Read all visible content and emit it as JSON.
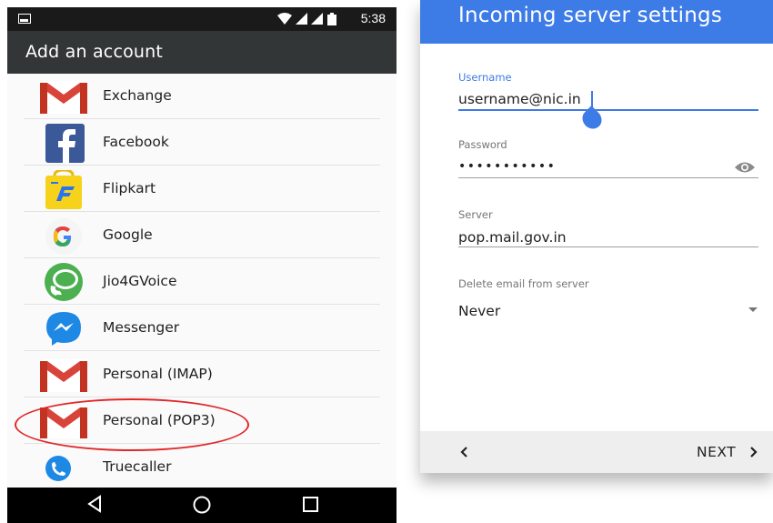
{
  "status_bar": {
    "time": "5:38"
  },
  "add_account": {
    "title": "Add an account",
    "accounts": [
      {
        "label": "Exchange",
        "icon": "gmail-icon"
      },
      {
        "label": "Facebook",
        "icon": "facebook-icon"
      },
      {
        "label": "Flipkart",
        "icon": "flipkart-icon"
      },
      {
        "label": "Google",
        "icon": "google-icon"
      },
      {
        "label": "Jio4GVoice",
        "icon": "jio4gvoice-icon"
      },
      {
        "label": "Messenger",
        "icon": "messenger-icon"
      },
      {
        "label": "Personal (IMAP)",
        "icon": "gmail-icon"
      },
      {
        "label": "Personal (POP3)",
        "icon": "gmail-icon"
      },
      {
        "label": "Truecaller",
        "icon": "truecaller-icon"
      }
    ],
    "highlighted": "Personal (POP3)",
    "highlight_color": "#e0282a"
  },
  "incoming_settings": {
    "title": "Incoming server settings",
    "username": {
      "label": "Username",
      "value": "username@nic.in"
    },
    "password": {
      "label": "Password",
      "value": "•••••••••••"
    },
    "server": {
      "label": "Server",
      "value": "pop.mail.gov.in"
    },
    "delete_email": {
      "label": "Delete email from server",
      "value": "Never"
    },
    "next_label": "NEXT",
    "accent_color": "#3d7be6"
  }
}
